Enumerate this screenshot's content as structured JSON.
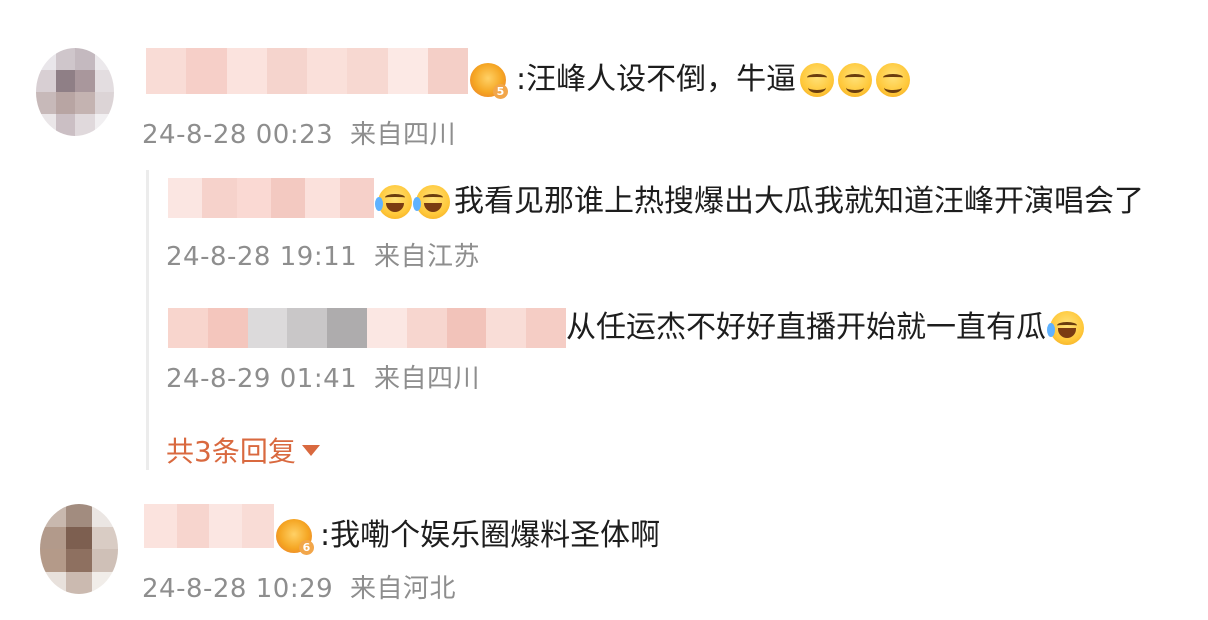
{
  "comments": [
    {
      "text": ":汪峰人设不倒，牛逼",
      "emojis": [
        "grin-icon",
        "grin-icon",
        "grin-icon"
      ],
      "time": "24-8-28 00:23",
      "location": "来自四川"
    },
    {
      "text": ":我嘞个娱乐圈爆料圣体啊",
      "time": "24-8-28 10:29",
      "location": "来自河北"
    }
  ],
  "replies": [
    {
      "text": "我看见那谁上热搜爆出大瓜我就知道汪峰开演唱会了",
      "time": "24-8-28 19:11",
      "location": "来自江苏"
    },
    {
      "text": "从任运杰不好好直播开始就一直有瓜",
      "time": "24-8-29 01:41",
      "location": "来自四川"
    }
  ],
  "more_replies": {
    "label": "共3条回复"
  },
  "colors": {
    "accent": "#d9693f",
    "meta_text": "#8e8e8e",
    "body_text": "#1d1d1d"
  }
}
